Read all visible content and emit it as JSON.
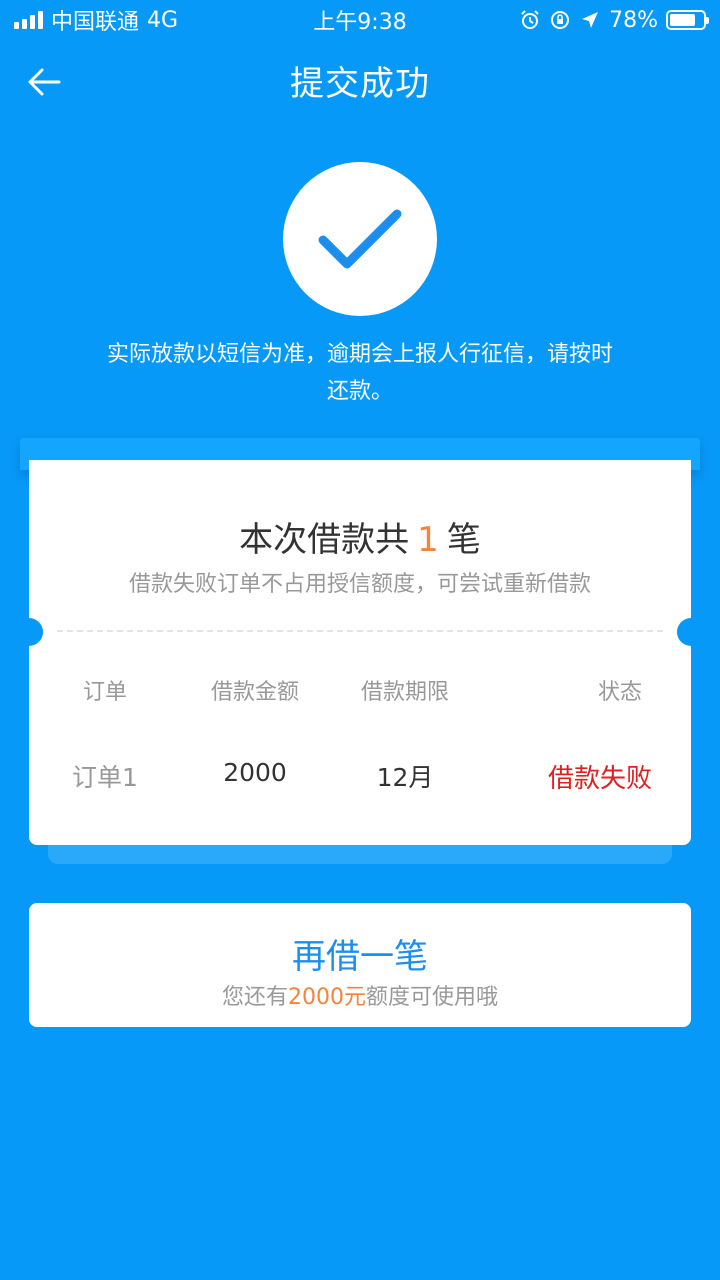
{
  "status_bar": {
    "carrier": "中国联通",
    "network": "4G",
    "time": "上午9:38",
    "battery": "78%",
    "battery_level": 0.78
  },
  "nav": {
    "title": "提交成功",
    "back_icon": "arrow-left-icon"
  },
  "result": {
    "icon": "check-icon",
    "notice": "实际放款以短信为准，逾期会上报人行征信，请按时还款。"
  },
  "ticket": {
    "title_prefix": "本次借款共",
    "count": "1",
    "title_suffix": "笔",
    "subtitle": "借款失败订单不占用授信额度，可尝试重新借款",
    "headers": [
      "订单",
      "借款金额",
      "借款期限",
      "状态"
    ],
    "rows": [
      {
        "order": "订单1",
        "amount": "2000",
        "term": "12月",
        "status": "借款失败"
      }
    ]
  },
  "again": {
    "title": "再借一笔",
    "sub_prefix": "您还有",
    "sub_amount": "2000元",
    "sub_suffix": "额度可使用哦"
  },
  "colors": {
    "background": "#0799F7",
    "accent_orange": "#F7823A",
    "fail_red": "#E02020",
    "link_blue": "#1B8EF0"
  }
}
